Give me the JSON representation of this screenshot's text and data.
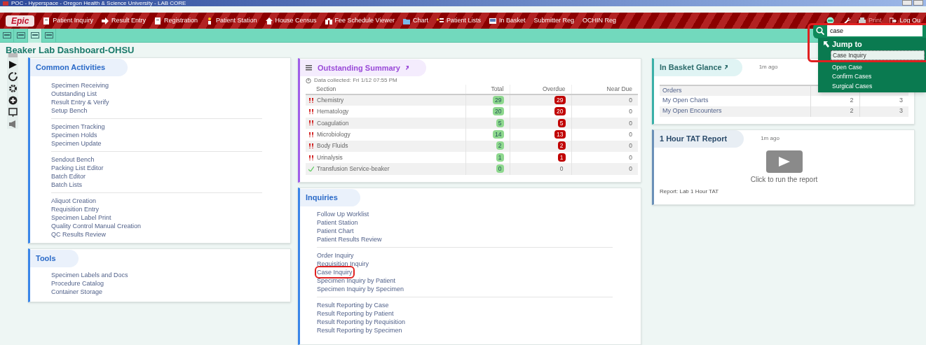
{
  "window": {
    "title": "POC - Hyperspace - Oregon Health & Science University - LAB CORE"
  },
  "menu": {
    "logo": "Epic",
    "items": [
      {
        "label": "Patient Inquiry",
        "kind": "doc"
      },
      {
        "label": "Result Entry",
        "kind": "arrow"
      },
      {
        "label": "Registration",
        "kind": "doc"
      },
      {
        "label": "Patient Station",
        "kind": "person"
      },
      {
        "label": "House Census",
        "kind": "house"
      },
      {
        "label": "Fee Schedule Viewer",
        "kind": "binoculars"
      },
      {
        "label": "Chart",
        "kind": "folder"
      },
      {
        "label": "Patient Lists",
        "kind": "list"
      },
      {
        "label": "In Basket",
        "kind": "tray"
      },
      {
        "label": "Submitter Reg",
        "kind": "none"
      },
      {
        "label": "OCHIN Reg",
        "kind": "none"
      }
    ],
    "right": [
      {
        "label": "Print",
        "kind": "print",
        "disabled": true
      },
      {
        "label": "Log Ou",
        "kind": "logout",
        "disabled": false
      }
    ]
  },
  "search": {
    "value": "case"
  },
  "jump_to": {
    "title": "Jump to",
    "highlighted": true,
    "items": [
      {
        "label": "Case Inquiry",
        "selected": true
      },
      {
        "label": "Open Case",
        "selected": false
      },
      {
        "label": "Confirm Cases",
        "selected": false
      },
      {
        "label": "Surgical Cases",
        "selected": false
      }
    ]
  },
  "page_title": "Beaker Lab Dashboard-OHSU",
  "common_activities": {
    "title": "Common Activities",
    "groups": [
      [
        "Specimen Receiving",
        "Outstanding List",
        "Result Entry & Verify",
        "Setup Bench"
      ],
      [
        "Specimen Tracking",
        "Specimen Holds",
        "Specimen Update"
      ],
      [
        "Sendout Bench",
        "Packing List Editor",
        "Batch Editor",
        "Batch Lists"
      ],
      [
        "Aliquot Creation",
        "Requisition Entry",
        "Specimen Label Print",
        "Quality Control Manual Creation",
        "QC Results Review"
      ]
    ]
  },
  "tools": {
    "title": "Tools",
    "items": [
      "Specimen Labels and Docs",
      "Procedure Catalog",
      "Container Storage"
    ]
  },
  "outstanding": {
    "title": "Outstanding Summary",
    "collected": "Data collected: Fri 1/12 07:55 PM",
    "columns": [
      "Section",
      "Total",
      "Overdue",
      "Near Due"
    ],
    "rows": [
      {
        "kind": "alert",
        "section": "Chemistry",
        "total": "29",
        "overdue": "29",
        "overdue_flag": true,
        "near_due": "0"
      },
      {
        "kind": "alert",
        "section": "Hematology",
        "total": "20",
        "overdue": "20",
        "overdue_flag": true,
        "near_due": "0"
      },
      {
        "kind": "alert",
        "section": "Coagulation",
        "total": "5",
        "overdue": "5",
        "overdue_flag": true,
        "near_due": "0"
      },
      {
        "kind": "alert",
        "section": "Microbiology",
        "total": "14",
        "overdue": "13",
        "overdue_flag": true,
        "near_due": "0"
      },
      {
        "kind": "alert",
        "section": "Body Fluids",
        "total": "2",
        "overdue": "2",
        "overdue_flag": true,
        "near_due": "0"
      },
      {
        "kind": "alert",
        "section": "Urinalysis",
        "total": "1",
        "overdue": "1",
        "overdue_flag": true,
        "near_due": "0"
      },
      {
        "kind": "ok",
        "section": "Transfusion Service-beaker",
        "total": "0",
        "overdue": "0",
        "overdue_flag": false,
        "near_due": "0"
      }
    ]
  },
  "inquiries": {
    "title": "Inquiries",
    "groups": [
      [
        {
          "label": "Follow Up Worklist",
          "highlighted": false
        },
        {
          "label": "Patient Station",
          "highlighted": false
        },
        {
          "label": "Patient Chart",
          "highlighted": false
        },
        {
          "label": "Patient Results Review",
          "highlighted": false
        }
      ],
      [
        {
          "label": "Order Inquiry",
          "highlighted": false
        },
        {
          "label": "Requisition Inquiry",
          "highlighted": false
        },
        {
          "label": "Case Inquiry",
          "highlighted": true
        },
        {
          "label": "Specimen Inquiry by Patient",
          "highlighted": false
        },
        {
          "label": "Specimen Inquiry by Specimen",
          "highlighted": false
        }
      ],
      [
        {
          "label": "Result Reporting by Case",
          "highlighted": false
        },
        {
          "label": "Result Reporting by Patient",
          "highlighted": false
        },
        {
          "label": "Result Reporting by Requisition",
          "highlighted": false
        },
        {
          "label": "Result Reporting by Specimen",
          "highlighted": false
        }
      ]
    ]
  },
  "in_basket": {
    "title": "In Basket Glance",
    "age": "1m ago",
    "rows": [
      {
        "label": "Orders"
      },
      {
        "label": "My Open Charts",
        "col_2": "2",
        "col_3": "3"
      },
      {
        "label": "My Open Encounters",
        "col_2": "2",
        "col_3": "3"
      }
    ]
  },
  "tat_report": {
    "title": "1 Hour TAT Report",
    "age": "1m ago",
    "action": "Click to run the report",
    "footer": "Report: Lab 1 Hour TAT"
  }
}
